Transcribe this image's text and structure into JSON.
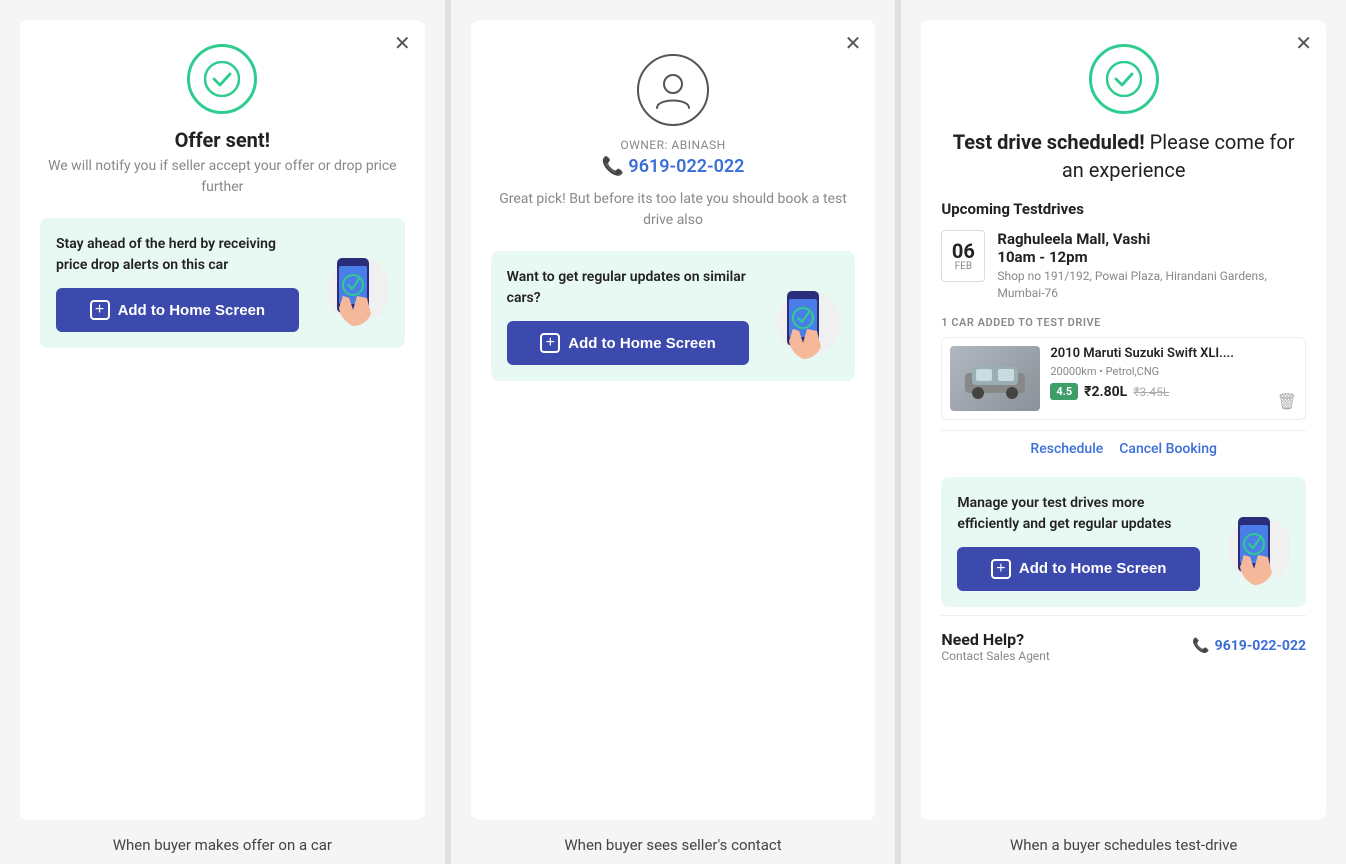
{
  "panel1": {
    "title": "Offer sent!",
    "subtitle": "We will notify you if seller accept your offer or drop price further",
    "highlight_text": "Stay ahead of the herd by receiving price drop alerts on this car",
    "add_btn_label": "Add to Home Screen",
    "caption": "When buyer makes offer on a car"
  },
  "panel2": {
    "owner_label": "OWNER: ABINASH",
    "phone": "9619-022-022",
    "body_text": "Great pick! But before its too late you should book a test drive also",
    "highlight_text": "Want to get regular updates on similar cars?",
    "add_btn_label": "Add to Home Screen",
    "caption": "When buyer sees seller's contact"
  },
  "panel3": {
    "title_bold": "Test drive scheduled!",
    "title_rest": " Please come for an experience",
    "upcoming_label": "Upcoming Testdrives",
    "date_day": "06",
    "date_month": "FEB",
    "location": "Raghuleela Mall, Vashi",
    "time": "10am - 12pm",
    "address": "Shop no 191/192, Powai Plaza, Hirandani Gardens, Mumbai-76",
    "car_added_label": "1 CAR ADDED TO TEST DRIVE",
    "car_name": "2010 Maruti Suzuki Swift XLI....",
    "car_meta": "20000km • Petrol,CNG",
    "car_rating": "4.5",
    "car_price": "₹2.80L",
    "car_price_old": "₹3.45L",
    "reschedule_label": "Reschedule",
    "cancel_label": "Cancel Booking",
    "manage_text": "Manage your test drives more efficiently and get regular updates",
    "add_btn_label": "Add to Home Screen",
    "help_title": "Need Help?",
    "help_subtitle": "Contact Sales Agent",
    "help_phone": "9619-022-022",
    "caption": "When a buyer schedules test-drive"
  },
  "colors": {
    "green": "#2ecc8e",
    "blue_btn": "#3d4aad",
    "blue_link": "#3a6ed8",
    "highlight_bg": "#e8f8f2"
  }
}
